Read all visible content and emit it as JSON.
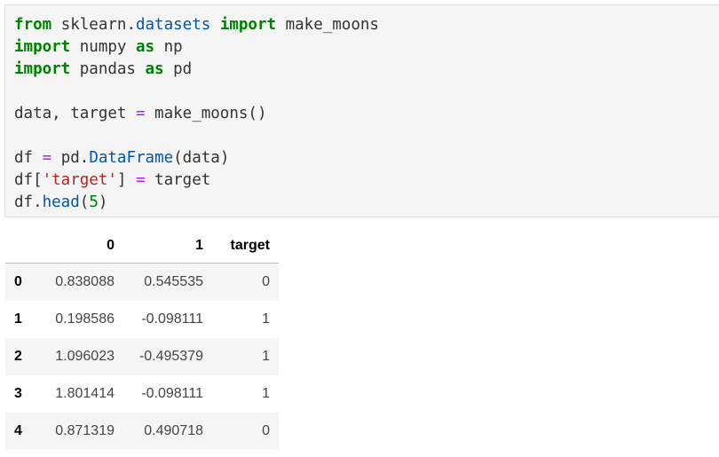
{
  "code_cell": {
    "lines": [
      [
        {
          "t": "from",
          "k": "kw"
        },
        {
          "t": " sklearn.",
          "k": ""
        },
        {
          "t": "datasets",
          "k": "fn"
        },
        {
          "t": " ",
          "k": ""
        },
        {
          "t": "import",
          "k": "kw"
        },
        {
          "t": " make_moons",
          "k": ""
        }
      ],
      [
        {
          "t": "import",
          "k": "kw"
        },
        {
          "t": " numpy ",
          "k": ""
        },
        {
          "t": "as",
          "k": "kw"
        },
        {
          "t": " np",
          "k": ""
        }
      ],
      [
        {
          "t": "import",
          "k": "kw"
        },
        {
          "t": " pandas ",
          "k": ""
        },
        {
          "t": "as",
          "k": "kw"
        },
        {
          "t": " pd",
          "k": ""
        }
      ],
      [],
      [
        {
          "t": "data, target ",
          "k": ""
        },
        {
          "t": "=",
          "k": "op"
        },
        {
          "t": " make_moons()",
          "k": ""
        }
      ],
      [],
      [
        {
          "t": "df ",
          "k": ""
        },
        {
          "t": "=",
          "k": "op"
        },
        {
          "t": " pd.",
          "k": ""
        },
        {
          "t": "DataFrame",
          "k": "fn"
        },
        {
          "t": "(data)",
          "k": ""
        }
      ],
      [
        {
          "t": "df[",
          "k": ""
        },
        {
          "t": "'target'",
          "k": "str"
        },
        {
          "t": "] ",
          "k": ""
        },
        {
          "t": "=",
          "k": "op"
        },
        {
          "t": " target",
          "k": ""
        }
      ],
      [
        {
          "t": "df.",
          "k": ""
        },
        {
          "t": "head",
          "k": "fn"
        },
        {
          "t": "(",
          "k": ""
        },
        {
          "t": "5",
          "k": "num"
        },
        {
          "t": ")",
          "k": ""
        }
      ]
    ]
  },
  "dataframe": {
    "columns": [
      "",
      "0",
      "1",
      "target"
    ],
    "rows": [
      {
        "index": "0",
        "c0": "0.838088",
        "c1": "0.545535",
        "target": "0"
      },
      {
        "index": "1",
        "c0": "0.198586",
        "c1": "-0.098111",
        "target": "1"
      },
      {
        "index": "2",
        "c0": "1.096023",
        "c1": "-0.495379",
        "target": "1"
      },
      {
        "index": "3",
        "c0": "1.801414",
        "c1": "-0.098111",
        "target": "1"
      },
      {
        "index": "4",
        "c0": "0.871319",
        "c1": "0.490718",
        "target": "0"
      }
    ]
  }
}
